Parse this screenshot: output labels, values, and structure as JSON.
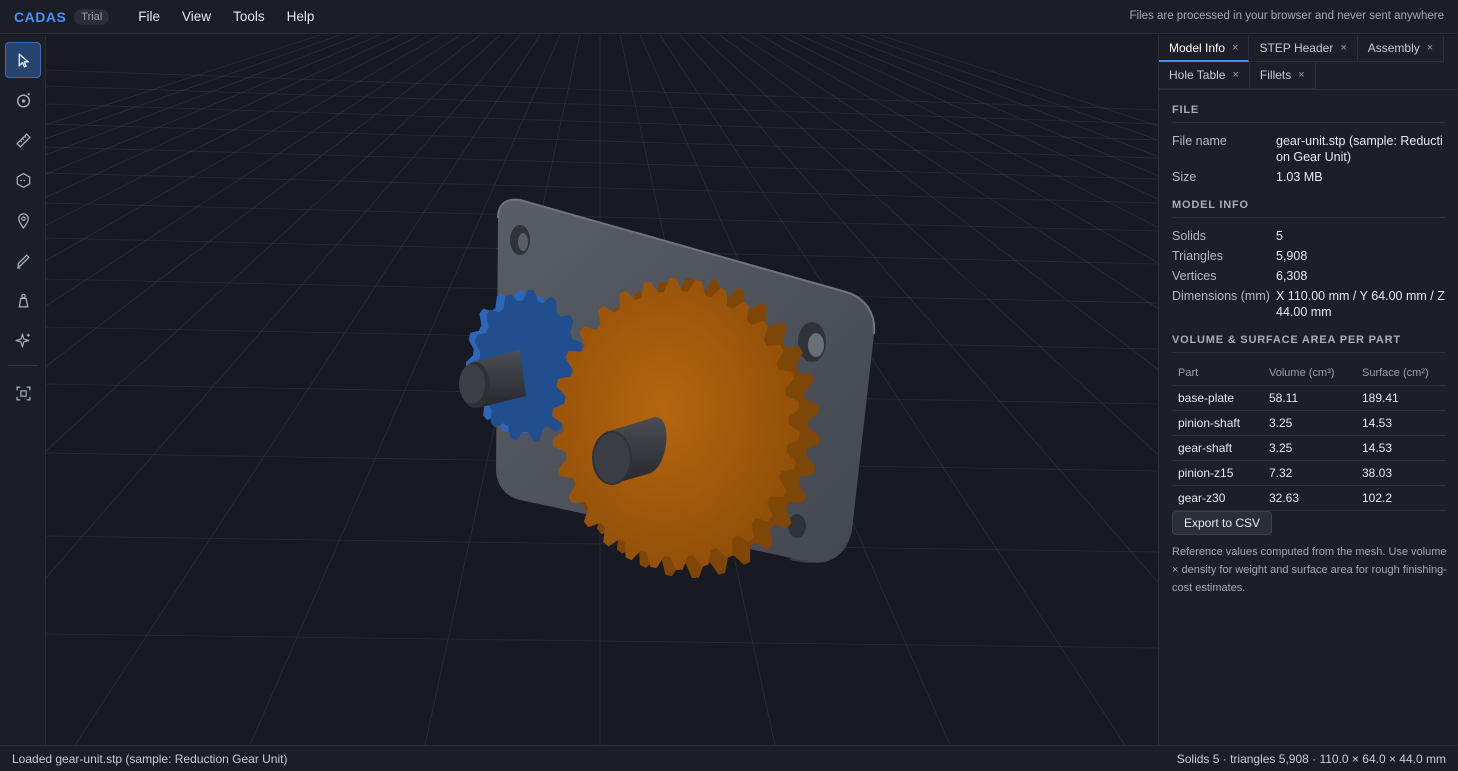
{
  "app": {
    "brand": "CADAS",
    "badge": "Trial"
  },
  "menu": {
    "file": "File",
    "view": "View",
    "tools": "Tools",
    "help": "Help"
  },
  "header": {
    "notice": "Files are processed in your browser and never sent anywhere"
  },
  "toolbar": {
    "tools": [
      "select-icon",
      "orbit-icon",
      "measure-icon",
      "section-icon",
      "pin-icon",
      "edge-icon",
      "weight-icon",
      "sparkle-icon",
      "fit-view-icon"
    ],
    "accent": "#4c8ff5"
  },
  "scene": {
    "colors": {
      "pinion": "#2e67b8",
      "gear": "#b4650e",
      "plate": "#4e525b",
      "shaft": "#34373d",
      "grid": "#3a3f4c"
    }
  },
  "panel": {
    "tabs": [
      {
        "label": "Model Info",
        "active": true
      },
      {
        "label": "STEP Header"
      },
      {
        "label": "Assembly"
      },
      {
        "label": "Hole Table"
      },
      {
        "label": "Fillets"
      }
    ],
    "close_glyph": "×",
    "file": {
      "title": "FILE",
      "name_label": "File name",
      "name_value": "gear-unit.stp (sample: Reduction Gear Unit)",
      "size_label": "Size",
      "size_value": "1.03 MB"
    },
    "model_info": {
      "title": "MODEL INFO",
      "solids_label": "Solids",
      "solids_value": "5",
      "triangles_label": "Triangles",
      "triangles_value": "5,908",
      "vertices_label": "Vertices",
      "vertices_value": "6,308",
      "dimensions_label": "Dimensions (mm)",
      "dimensions_value": "X 110.00 mm / Y 64.00 mm / Z 44.00 mm"
    },
    "volume": {
      "title": "VOLUME & SURFACE AREA PER PART",
      "columns": [
        "Part",
        "Volume (cm³)",
        "Surface (cm²)"
      ],
      "rows": [
        [
          "base-plate",
          "58.11",
          "189.41"
        ],
        [
          "pinion-shaft",
          "3.25",
          "14.53"
        ],
        [
          "gear-shaft",
          "3.25",
          "14.53"
        ],
        [
          "pinion-z15",
          "7.32",
          "38.03"
        ],
        [
          "gear-z30",
          "32.63",
          "102.2"
        ]
      ],
      "export_label": "Export to CSV",
      "note": "Reference values computed from the mesh. Use volume × density for weight and surface area for rough finishing-cost estimates."
    }
  },
  "status": {
    "left": "Loaded gear-unit.stp (sample: Reduction Gear Unit)",
    "right": "Solids 5 · triangles 5,908 · 110.0 × 64.0 × 44.0 mm"
  }
}
